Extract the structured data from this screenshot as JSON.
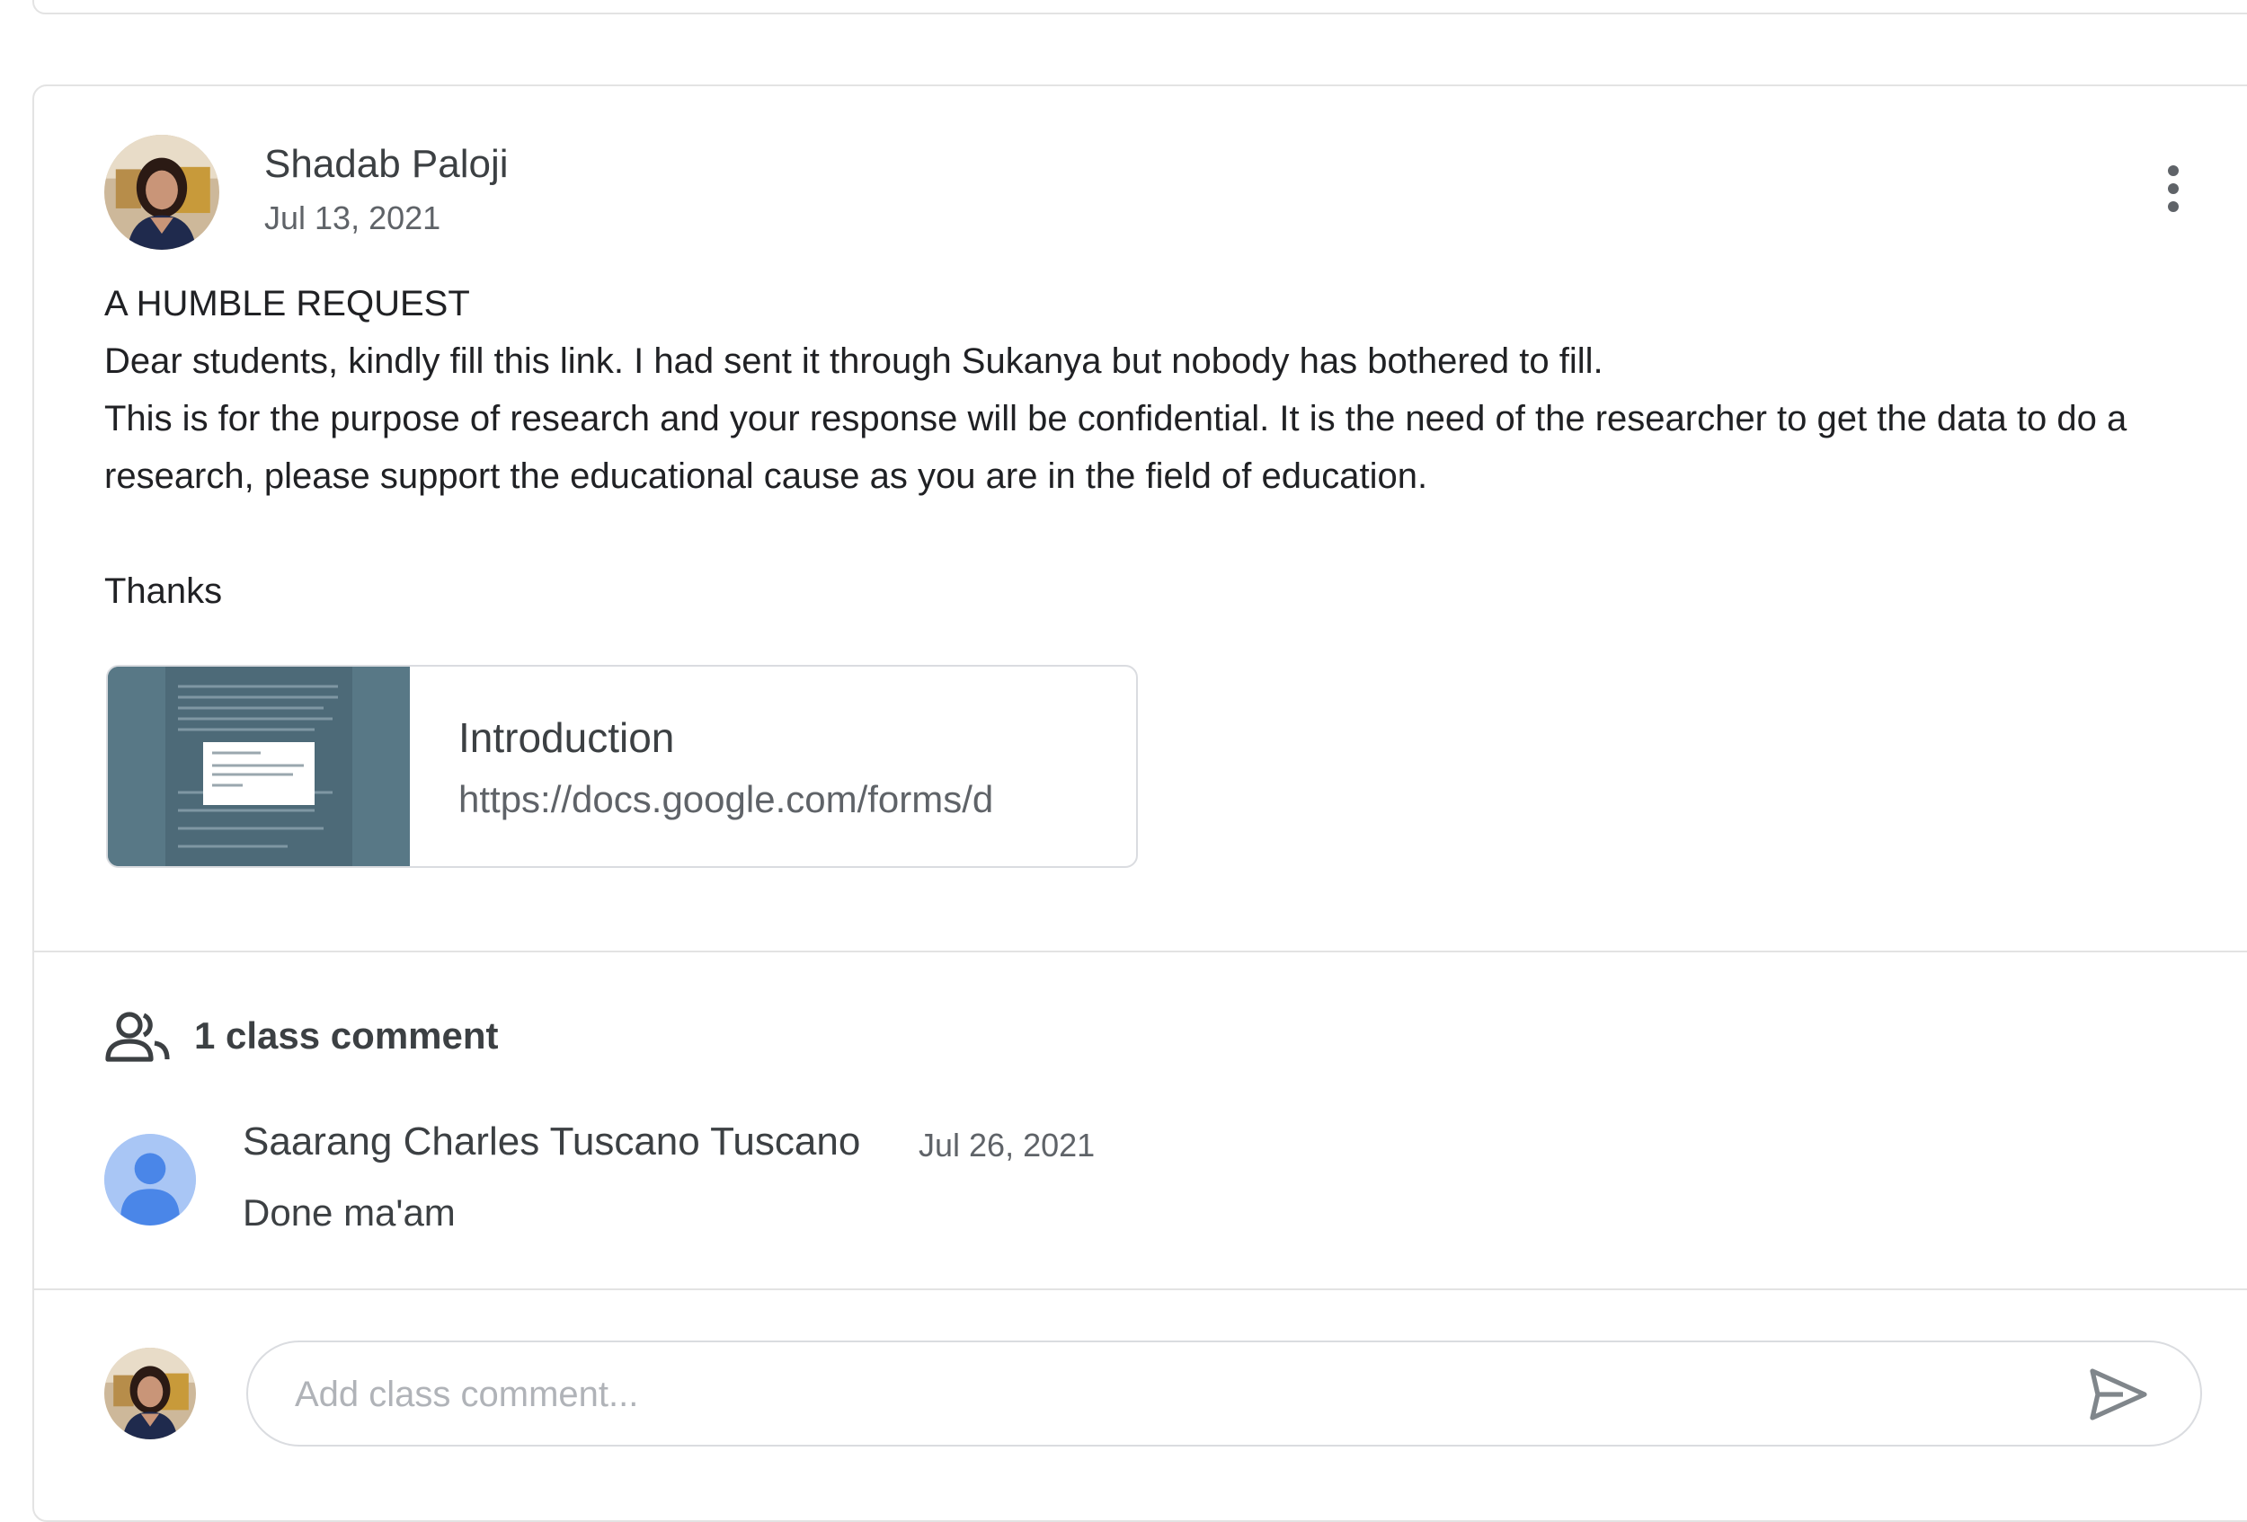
{
  "post": {
    "author": "Shadab Paloji",
    "date": "Jul 13, 2021",
    "more_icon": "more-vert-icon",
    "body": {
      "heading": "A HUMBLE REQUEST",
      "line1": "Dear students, kindly fill this link. I had sent it through Sukanya but nobody has bothered to fill.",
      "line2": "This is for the purpose of research and your response will be confidential. It is the need of the researcher to get the data to do a",
      "line3": "research, please support the educational cause as you are in the field of education.",
      "sign_off": "Thanks"
    },
    "attachment": {
      "title": "Introduction",
      "url": "https://docs.google.com/forms/d"
    }
  },
  "comments": {
    "icon": "people-icon",
    "count_label": "1 class comment",
    "items": [
      {
        "author": "Saarang Charles Tuscano Tuscano",
        "date": "Jul 26, 2021",
        "text": "Done ma'am"
      }
    ]
  },
  "composer": {
    "placeholder": "Add class comment...",
    "value": "",
    "send_icon": "send-icon"
  },
  "colors": {
    "text": "#3c4043",
    "secondary_text": "#5f6368",
    "border": "#e3e3e3",
    "attachment_thumb": "#587886",
    "default_avatar": "#a9c6f5",
    "default_avatar_figure": "#4a86e8"
  }
}
